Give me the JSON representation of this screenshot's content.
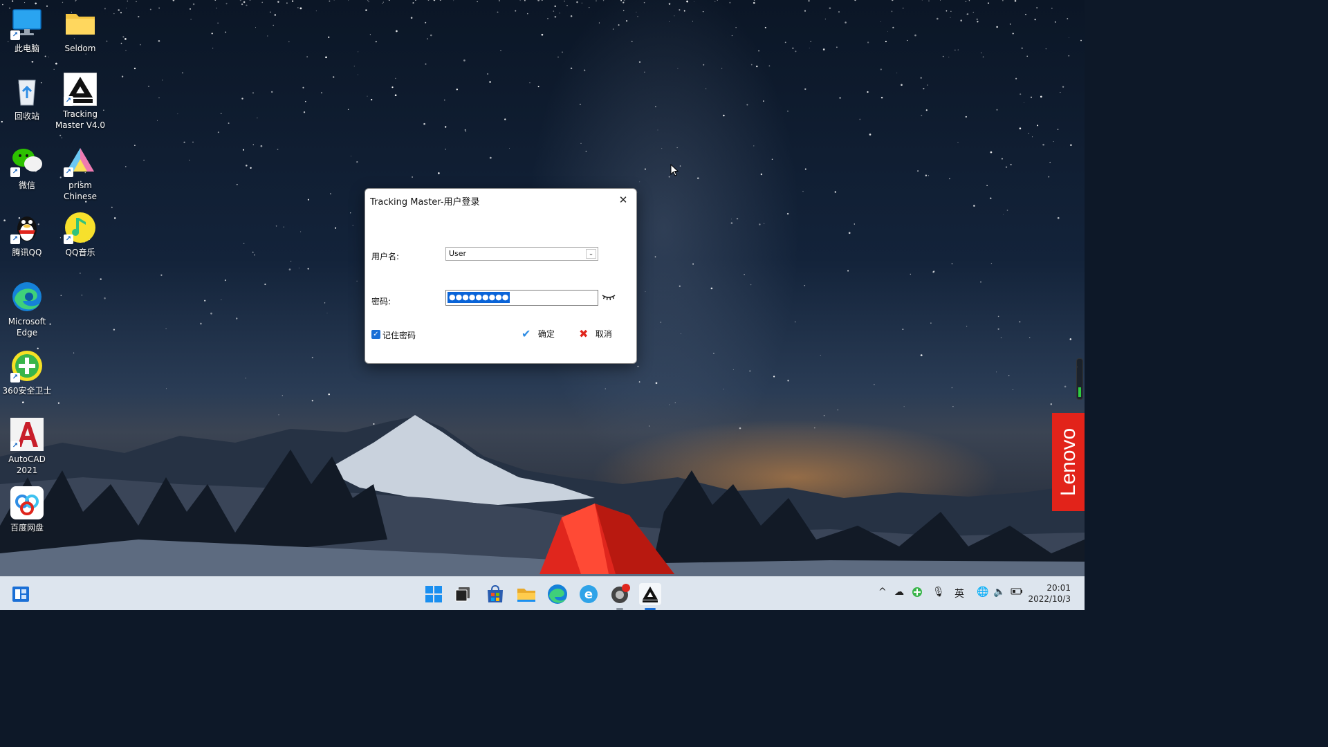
{
  "desktop": {
    "icons": [
      {
        "label": "此电脑"
      },
      {
        "label": "Seldom"
      },
      {
        "label": "回收站"
      },
      {
        "label": "Tracking\nMaster V4.0"
      },
      {
        "label": "微信"
      },
      {
        "label": "prism\nChinese"
      },
      {
        "label": "腾讯QQ"
      },
      {
        "label": "QQ音乐"
      },
      {
        "label": "Microsoft\nEdge"
      },
      {
        "label": "360安全卫士"
      },
      {
        "label": "AutoCAD\n2021"
      },
      {
        "label": "百度网盘"
      }
    ]
  },
  "dialog": {
    "title": "Tracking Master-用户登录",
    "username_label": "用户名:",
    "username_value": "User",
    "password_label": "密码:",
    "password_value": "●●●●●●●●●",
    "remember_label": "记住密码",
    "remember_checked": true,
    "ok_label": "确定",
    "cancel_label": "取消"
  },
  "brand": {
    "lenovo": "Lenovo",
    "color": "#e2231a"
  },
  "taskbar": {
    "pinned": [
      "start-icon",
      "task-view-icon",
      "store-icon",
      "file-explorer-icon",
      "edge-icon",
      "ie-icon",
      "app-icon",
      "tracking-master-icon"
    ],
    "tray_ime": "英",
    "time": "20:01",
    "date": "2022/10/3"
  },
  "colors": {
    "accent": "#1a6fd6",
    "selection": "#0a64d8"
  }
}
